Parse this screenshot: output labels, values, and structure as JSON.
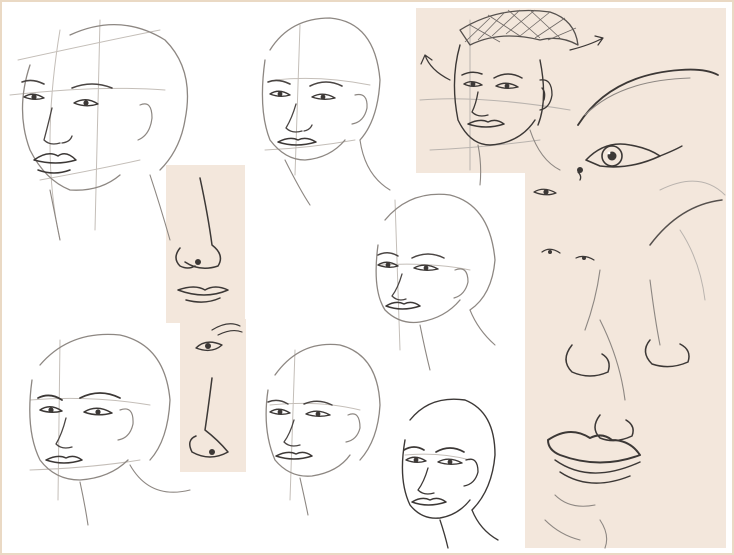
{
  "image": {
    "kind": "pencil sketch study sheet",
    "colors": {
      "paper": "#ffffff",
      "panel_tint": "#f3e7dc",
      "border": "#ead9c4",
      "pencil_light": "#b9b3ae",
      "pencil_mid": "#8d8782",
      "pencil_dark": "#3c3836"
    }
  }
}
